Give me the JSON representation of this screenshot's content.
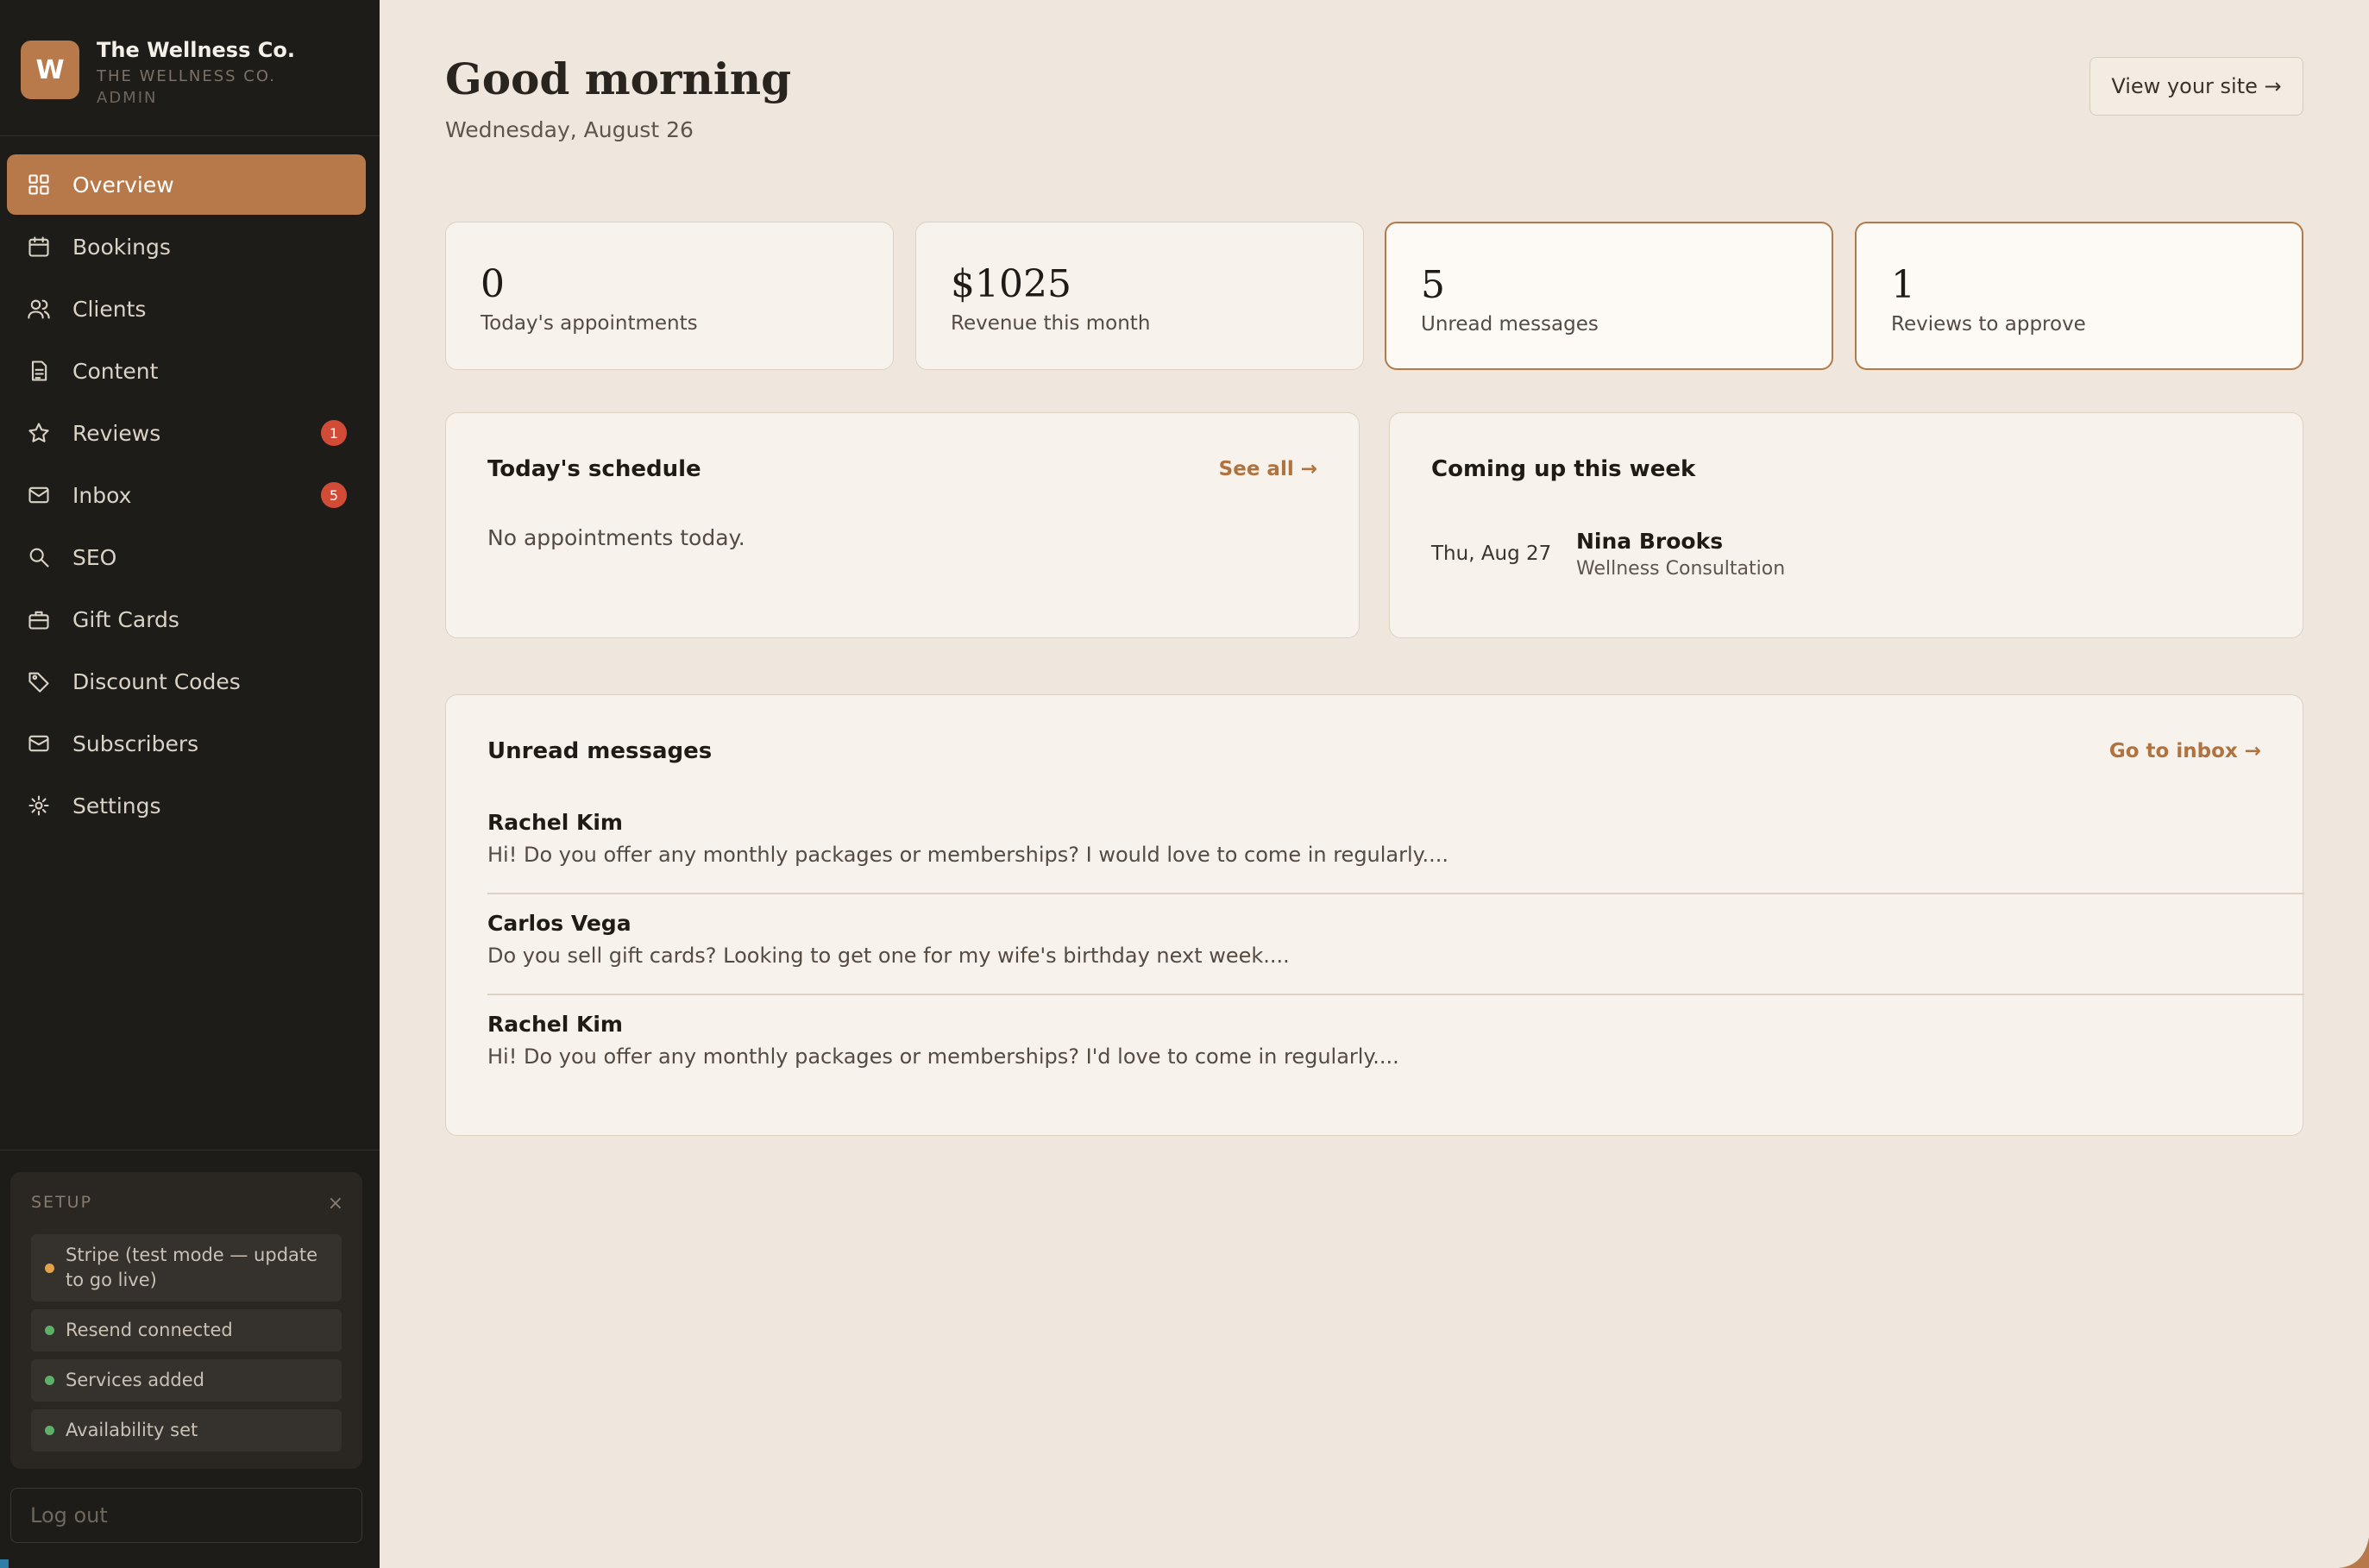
{
  "brand": {
    "initial": "W",
    "name": "The Wellness Co.",
    "subtitle": "THE WELLNESS CO.",
    "role": "ADMIN"
  },
  "nav": [
    {
      "label": "Overview",
      "icon": "grid-icon",
      "active": true
    },
    {
      "label": "Bookings",
      "icon": "calendar-icon"
    },
    {
      "label": "Clients",
      "icon": "users-icon"
    },
    {
      "label": "Content",
      "icon": "document-icon"
    },
    {
      "label": "Reviews",
      "icon": "star-icon",
      "badge": "1"
    },
    {
      "label": "Inbox",
      "icon": "mail-icon",
      "badge": "5"
    },
    {
      "label": "SEO",
      "icon": "search-icon"
    },
    {
      "label": "Gift Cards",
      "icon": "gift-icon"
    },
    {
      "label": "Discount Codes",
      "icon": "tag-icon"
    },
    {
      "label": "Subscribers",
      "icon": "envelope-icon"
    },
    {
      "label": "Settings",
      "icon": "gear-icon"
    }
  ],
  "setup": {
    "title": "SETUP",
    "close": "×",
    "items": [
      {
        "text": "Stripe (test mode — update to go live)",
        "status": "warning"
      },
      {
        "text": "Resend connected",
        "status": "ok"
      },
      {
        "text": "Services added",
        "status": "ok"
      },
      {
        "text": "Availability set",
        "status": "ok"
      }
    ]
  },
  "logout": "Log out",
  "header": {
    "greeting": "Good morning",
    "date": "Wednesday, August 26",
    "view_site": "View your site →"
  },
  "stats": [
    {
      "value": "0",
      "label": "Today's appointments"
    },
    {
      "value": "$1025",
      "label": "Revenue this month"
    },
    {
      "value": "5",
      "label": "Unread messages"
    },
    {
      "value": "1",
      "label": "Reviews to approve"
    }
  ],
  "schedule": {
    "title": "Today's schedule",
    "link": "See all →",
    "empty": "No appointments today."
  },
  "upcoming": {
    "title": "Coming up this week",
    "items": [
      {
        "date": "Thu, Aug 27",
        "name": "Nina Brooks",
        "service": "Wellness Consultation"
      }
    ]
  },
  "messages": {
    "title": "Unread messages",
    "link": "Go to inbox →",
    "items": [
      {
        "name": "Rachel Kim",
        "text": "Hi! Do you offer any monthly packages or memberships? I would love to come in regularly...."
      },
      {
        "name": "Carlos Vega",
        "text": "Do you sell gift cards? Looking to get one for my wife's birthday next week...."
      },
      {
        "name": "Rachel Kim",
        "text": "Hi! Do you offer any monthly packages or memberships? I'd love to come in regularly...."
      }
    ]
  },
  "colors": {
    "accent": "#b8794a",
    "sidebar": "#1e1c19",
    "background": "#efe7dd",
    "badge": "#d24b36",
    "status_ok": "#5fae6a",
    "status_warning": "#e0a24a"
  }
}
